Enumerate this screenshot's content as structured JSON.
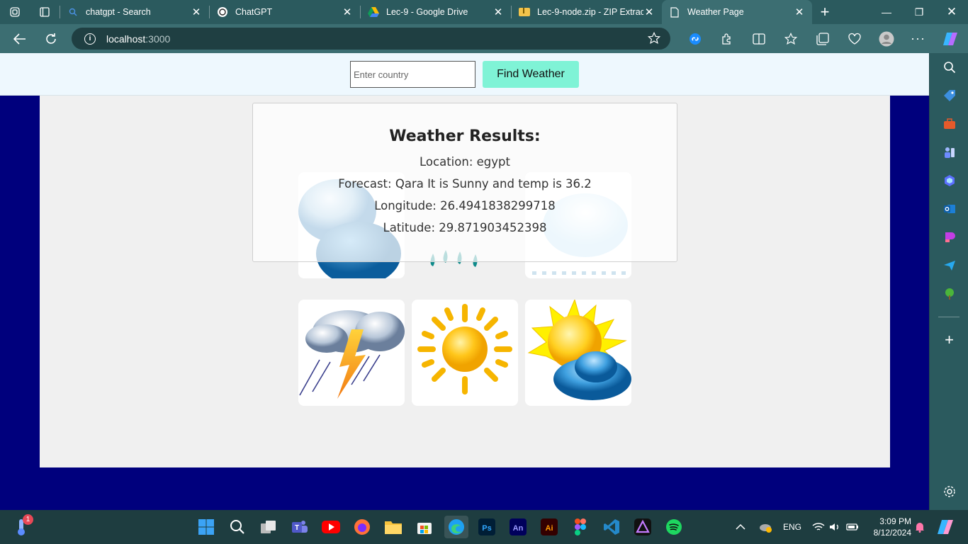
{
  "browser": {
    "tabs": [
      {
        "title": "chatgpt - Search",
        "favicon": "search-icon"
      },
      {
        "title": "ChatGPT",
        "favicon": "chatgpt-icon"
      },
      {
        "title": "Lec-9 - Google Drive",
        "favicon": "google-drive-icon"
      },
      {
        "title": "Lec-9-node.zip - ZIP Extract",
        "favicon": "zip-icon"
      },
      {
        "title": "Weather Page",
        "favicon": "page-icon",
        "active": true
      }
    ],
    "address": {
      "host": "localhost",
      "port": ":3000"
    }
  },
  "page": {
    "search": {
      "placeholder": "Enter country",
      "button_label": "Find Weather"
    },
    "results": {
      "heading": "Weather Results:",
      "location": "Location: egypt",
      "forecast": "Forecast: Qara It is Sunny and temp is 36.2",
      "longitude": "Longitude: 26.4941838299718",
      "latitude": "Latitude: 29.871903452398"
    },
    "tiles": [
      "dark-cloud-icon",
      "rain-icon",
      "snow-cloud-icon",
      "thunderstorm-icon",
      "sun-icon",
      "partly-sunny-icon"
    ]
  },
  "taskbar": {
    "notification_badge": "1",
    "language": "ENG",
    "time": "3:09 PM",
    "date": "8/12/2024"
  },
  "colors": {
    "page_background": "#00007d",
    "panel": "#f0f0f0",
    "button": "#7ff3d6",
    "browser_chrome": "#3c6e72"
  }
}
